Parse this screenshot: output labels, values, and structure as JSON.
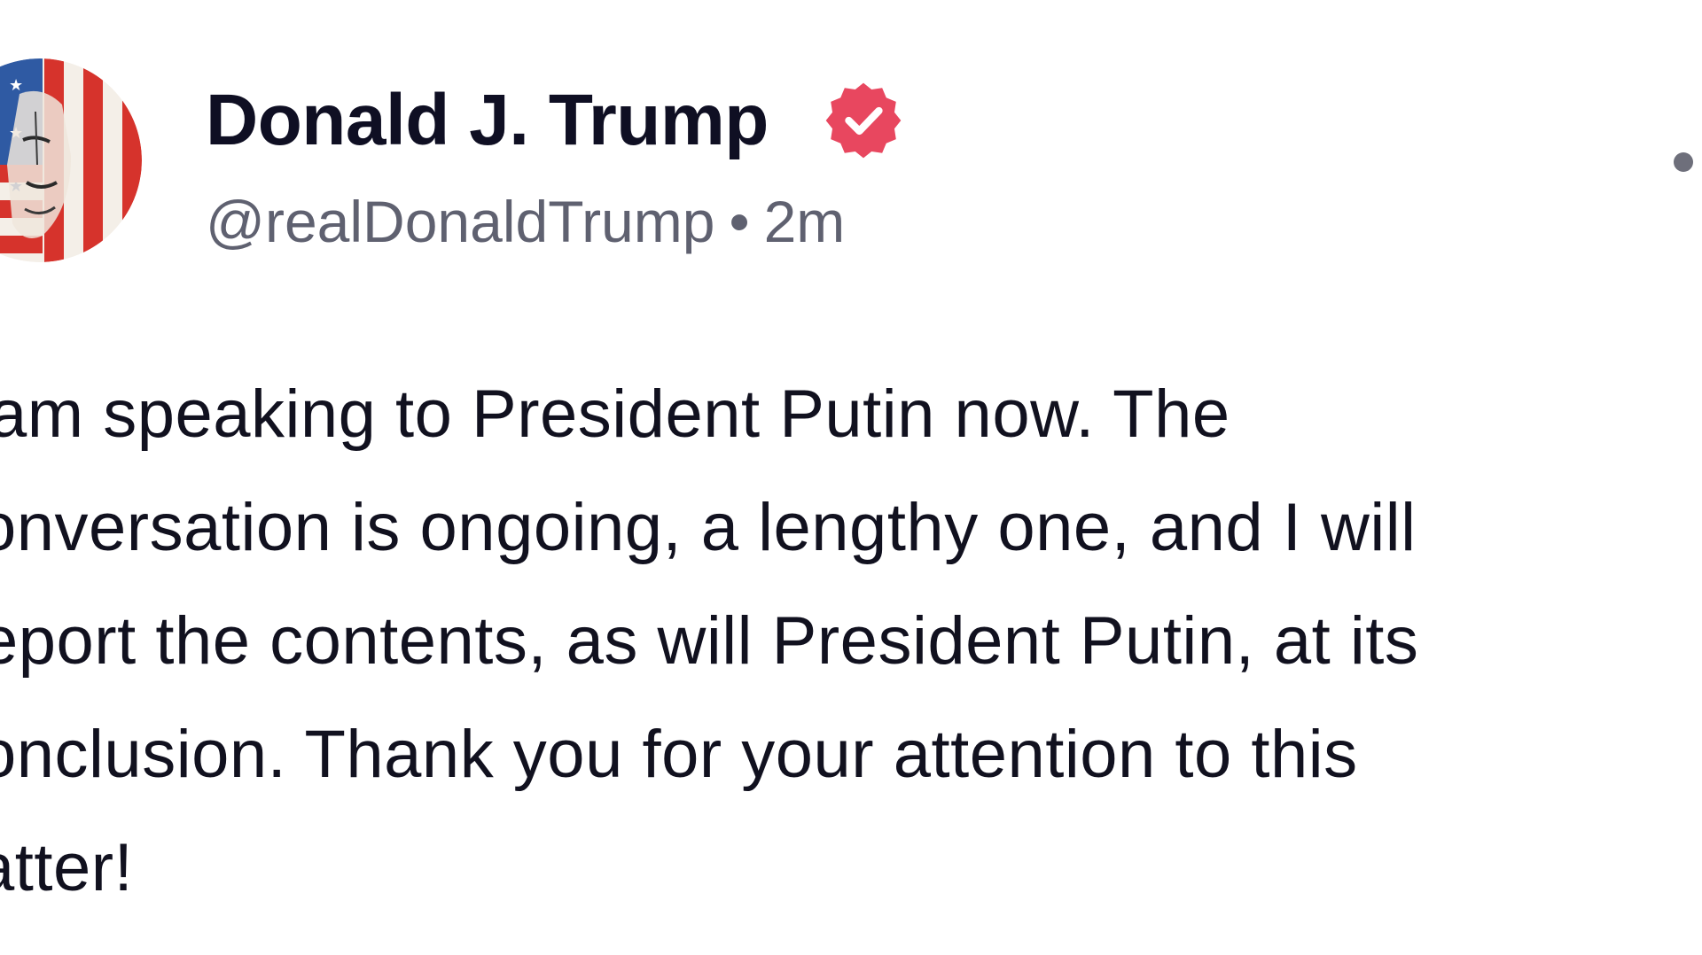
{
  "author": {
    "display_name": "Donald J. Trump",
    "handle": "@realDonaldTrump",
    "separator": "•",
    "time_ago": "2m",
    "verified": true,
    "avatar_icon": "flag-portrait-avatar",
    "verified_icon": "verified-badge-icon",
    "verified_color": "#e8475f"
  },
  "post": {
    "text_lines": [
      "am speaking to President Putin now. The",
      "onversation is ongoing, a lengthy one, and I will",
      "eport the contents, as will President Putin, at its",
      "onclusion. Thank you for your attention to this",
      "atter!"
    ]
  },
  "menu": {
    "icon": "more-options-icon"
  },
  "colors": {
    "name": "#0f0f23",
    "meta": "#5f6170",
    "body": "#11111f",
    "background": "#ffffff"
  }
}
